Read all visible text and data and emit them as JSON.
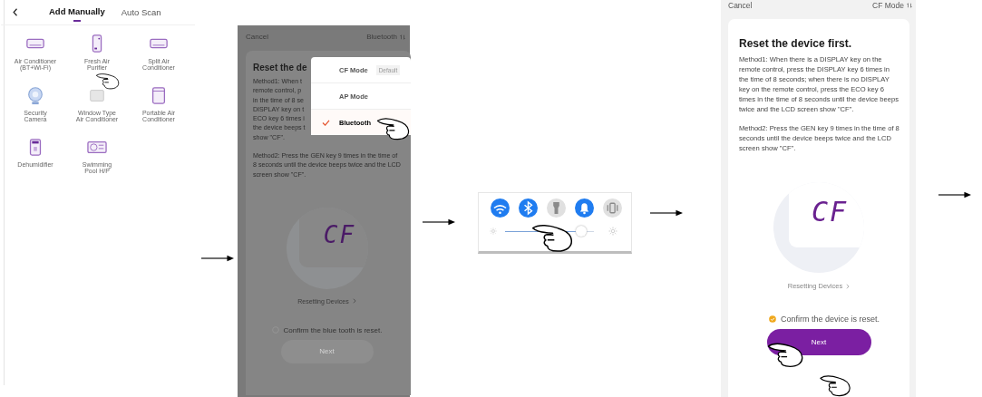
{
  "device_picker": {
    "tabs": [
      {
        "label": "Add Manually",
        "selected": true
      },
      {
        "label": "Auto Scan",
        "selected": false
      }
    ],
    "devices": [
      {
        "kind": "split_ac",
        "label": "Air Conditioner\n(BT+Wi-Fi)"
      },
      {
        "kind": "purifier",
        "label": "Fresh Air\nPurifier"
      },
      {
        "kind": "split_ac",
        "label": "Split Air\nConditioner"
      },
      {
        "kind": "camera",
        "label": "Security\nCamera"
      },
      {
        "kind": "window_ac",
        "label": "Window Type\nAir Conditioner"
      },
      {
        "kind": "portable_ac",
        "label": "Portable Air\nConditioner"
      },
      {
        "kind": "dehumidifier",
        "label": "Dehumidifier"
      },
      {
        "kind": "pool",
        "label": "Swimming\nPool H/P"
      }
    ]
  },
  "mode_menu_screen": {
    "cancel": "Cancel",
    "mode": "Bluetooth",
    "title": "Reset the de",
    "method1_lines": [
      "Method1: When t",
      "remote control, p",
      "in the time of 8 se",
      "DISPLAY key on t",
      "ECO key 6 times i",
      "the device beeps t",
      "show \"CF\"."
    ],
    "method2": "Method2: Press the GEN key 9 times in the time of 8 seconds until the device beeps twice and the LCD screen show \"CF\".",
    "display": "CF",
    "resetting_link": "Resetting Devices",
    "confirm": {
      "label": "Confirm the blue tooth is reset.",
      "checked": false
    },
    "next": {
      "label": "Next",
      "disabled": true
    },
    "menu": [
      {
        "label": "CF Mode",
        "badge": "Default",
        "selected": false
      },
      {
        "label": "AP Mode",
        "selected": false
      },
      {
        "label": "Bluetooth",
        "selected": true
      }
    ]
  },
  "quick_settings": {
    "toggles": [
      {
        "kind": "wifi",
        "on": true
      },
      {
        "kind": "bluetooth",
        "on": true
      },
      {
        "kind": "flashlight",
        "on": false
      },
      {
        "kind": "bell",
        "on": true
      },
      {
        "kind": "vibrate",
        "on": false
      }
    ],
    "brightness": {
      "level": 0.86
    }
  },
  "reset_screen": {
    "cancel": "Cancel",
    "mode": "CF Mode",
    "title": "Reset the device first.",
    "method1": "Method1: When there is a DISPLAY key on the remote control, press the DISPLAY key 6 times in the time of 8 seconds; when there is no DISPLAY key on the remote control, press the ECO key 6 times in the time of 8 seconds until the device beeps twice and the LCD screen show \"CF\".",
    "method2": "Method2: Press the GEN key 9 times in the time of 8 seconds until the device beeps twice and the LCD screen show \"CF\".",
    "display": "CF",
    "resetting_link": "Resetting Devices",
    "confirm": {
      "label": "Confirm the device is reset.",
      "checked": true
    },
    "next": {
      "label": "Next",
      "disabled": false
    }
  }
}
